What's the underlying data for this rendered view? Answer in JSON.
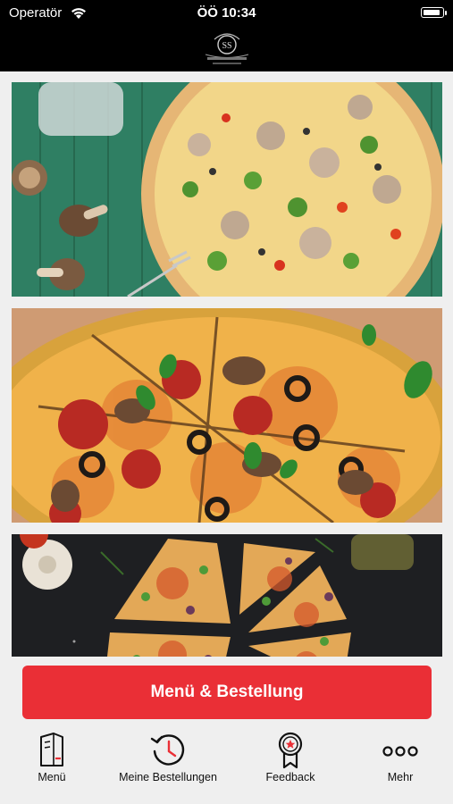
{
  "status_bar": {
    "carrier": "Operatör",
    "time": "ÖÖ 10:34",
    "battery_level": 0.9
  },
  "header": {
    "logo_icon": "restaurant-crest-logo",
    "logo_text": "SS"
  },
  "banners": [
    {
      "name": "pizza-banner-1",
      "subject": "vegetable pizza on green wood"
    },
    {
      "name": "pizza-banner-2",
      "subject": "pepperoni olive pizza on parchment"
    },
    {
      "name": "pizza-banner-3",
      "subject": "sliced pizza on dark slate"
    }
  ],
  "order_button": {
    "label": "Menü & Bestellung",
    "color": "#ea2f36"
  },
  "tabs": [
    {
      "label": "Menü",
      "icon": "menu-book-icon"
    },
    {
      "label": "Meine Bestellungen",
      "icon": "order-history-icon"
    },
    {
      "label": "Feedback",
      "icon": "award-badge-icon"
    },
    {
      "label": "Mehr",
      "icon": "more-dots-icon"
    }
  ],
  "colors": {
    "accent": "#ea2f36",
    "header_bg": "#000000",
    "page_bg": "#efefef"
  }
}
